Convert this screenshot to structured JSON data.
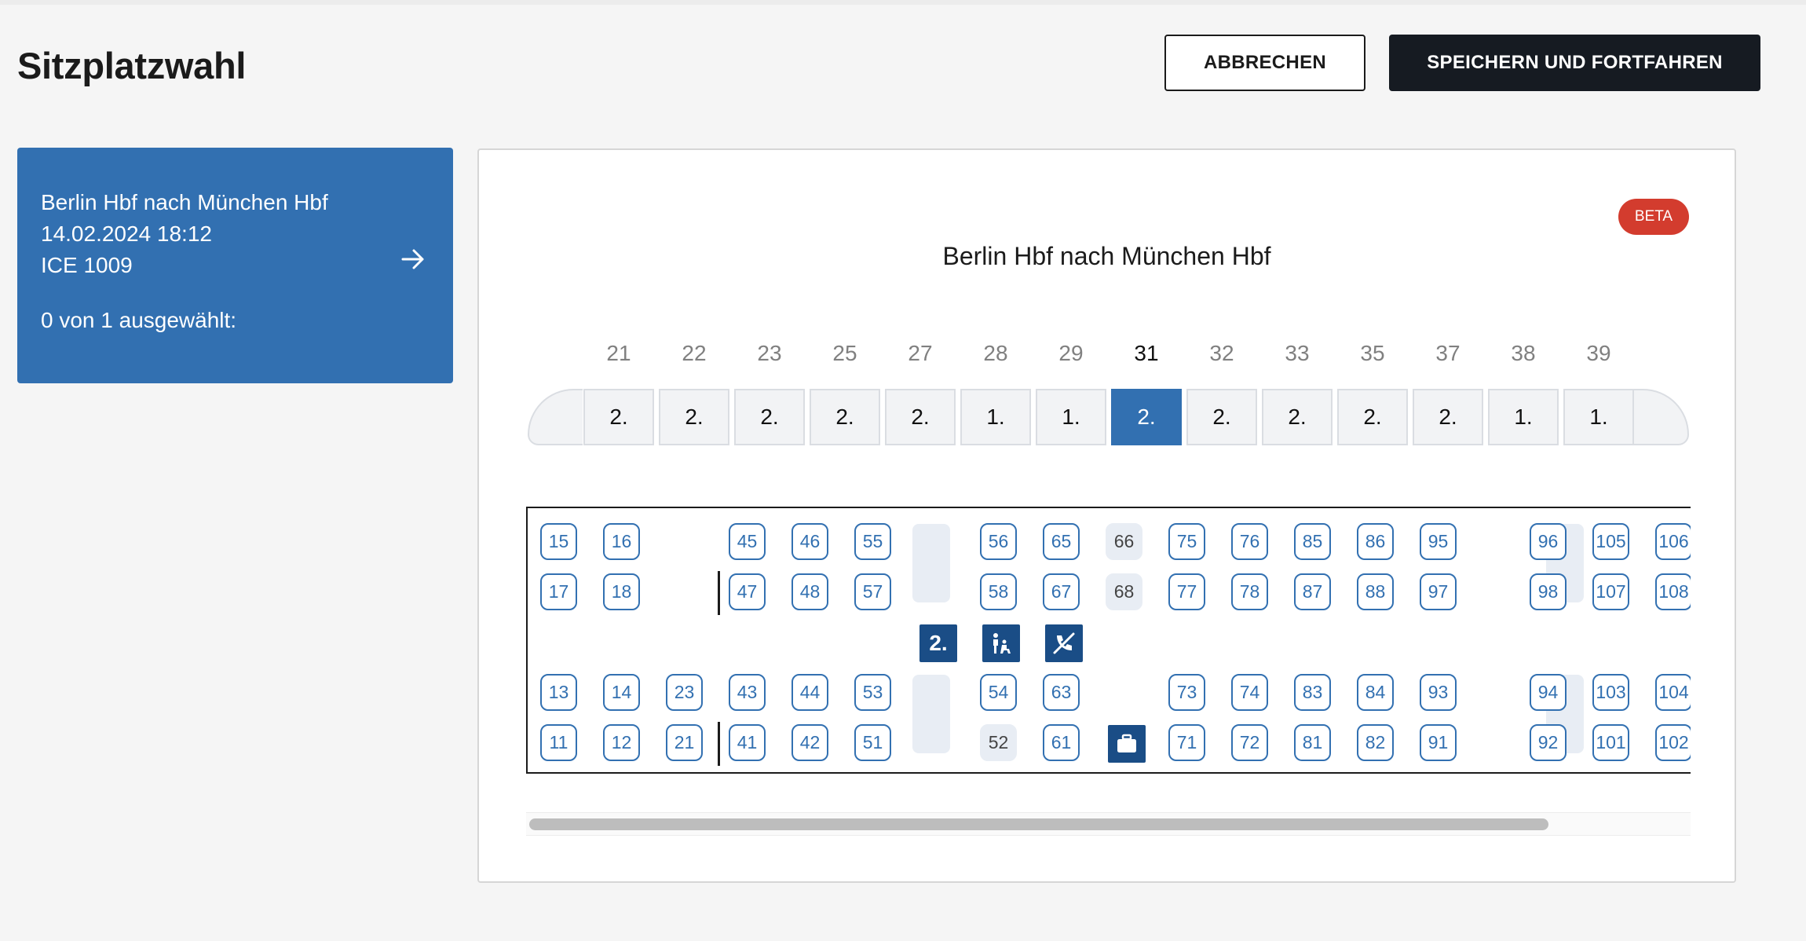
{
  "header": {
    "title": "Sitzplatzwahl",
    "cancel_label": "ABBRECHEN",
    "save_label": "SPEICHERN UND FORTFAHREN"
  },
  "journey": {
    "route": "Berlin Hbf nach München Hbf",
    "datetime": "14.02.2024 18:12",
    "train": "ICE 1009",
    "selection": "0 von 1 ausgewählt:"
  },
  "seatmap": {
    "badge": "BETA",
    "title": "Berlin Hbf nach München Hbf",
    "wagons": [
      {
        "number": "21",
        "class": "2."
      },
      {
        "number": "22",
        "class": "2."
      },
      {
        "number": "23",
        "class": "2."
      },
      {
        "number": "25",
        "class": "2."
      },
      {
        "number": "27",
        "class": "2."
      },
      {
        "number": "28",
        "class": "1."
      },
      {
        "number": "29",
        "class": "1."
      },
      {
        "number": "31",
        "class": "2.",
        "active": true
      },
      {
        "number": "32",
        "class": "2."
      },
      {
        "number": "33",
        "class": "2."
      },
      {
        "number": "35",
        "class": "2."
      },
      {
        "number": "37",
        "class": "2."
      },
      {
        "number": "38",
        "class": "1."
      },
      {
        "number": "39",
        "class": "1."
      }
    ],
    "class_symbol": "2.",
    "seats": {
      "row1": [
        "15",
        "16",
        "45",
        "46",
        "55",
        "56",
        "65",
        "66",
        "75",
        "76",
        "85",
        "86",
        "95",
        "96",
        "105",
        "106"
      ],
      "row2": [
        "17",
        "18",
        "47",
        "48",
        "57",
        "58",
        "67",
        "68",
        "77",
        "78",
        "87",
        "88",
        "97",
        "98",
        "107",
        "108"
      ],
      "row3": [
        "13",
        "14",
        "23",
        "43",
        "44",
        "53",
        "54",
        "63",
        "73",
        "74",
        "83",
        "84",
        "93",
        "94",
        "103",
        "104"
      ],
      "row4": [
        "11",
        "12",
        "21",
        "41",
        "42",
        "51",
        "52",
        "61",
        "71",
        "72",
        "81",
        "82",
        "91",
        "92",
        "101",
        "102"
      ],
      "taken": [
        "66",
        "68",
        "52"
      ]
    },
    "icons": [
      "second-class-icon",
      "family-area-icon",
      "no-phone-quiet-zone-icon",
      "luggage-icon"
    ],
    "scroll_fraction": 0.88
  }
}
